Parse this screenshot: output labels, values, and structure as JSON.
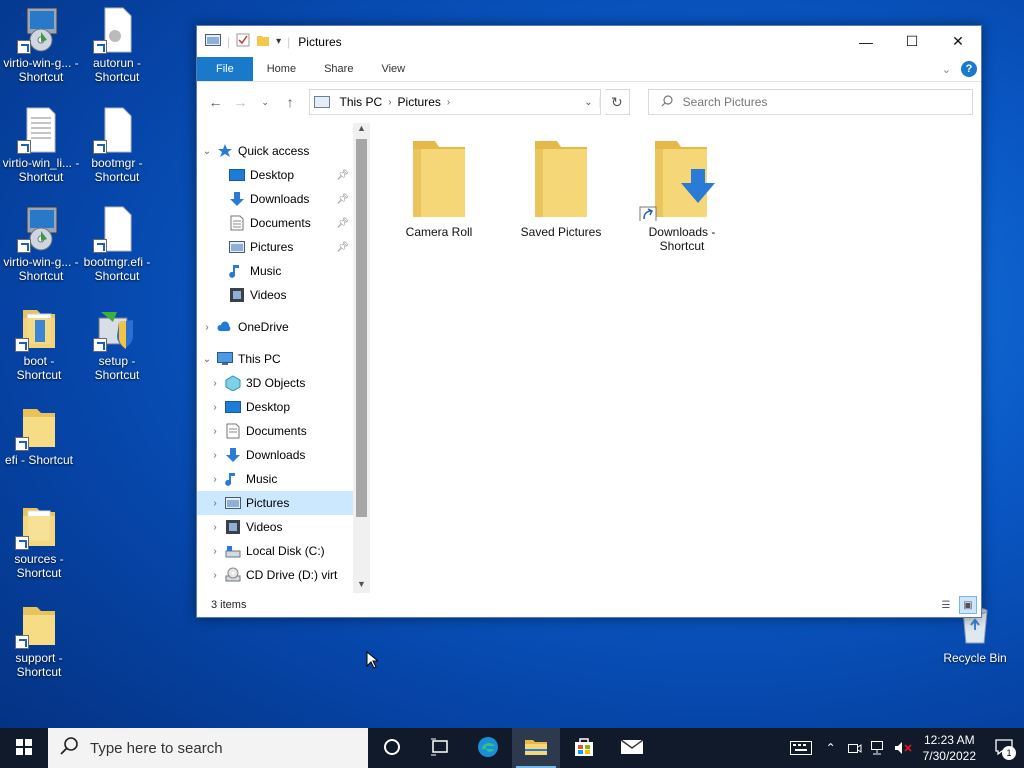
{
  "desktop": {
    "icons": [
      {
        "label": "virtio-win-g... - Shortcut",
        "type": "installer"
      },
      {
        "label": "autorun - Shortcut",
        "type": "file"
      },
      {
        "label": "virtio-win_li... - Shortcut",
        "type": "document"
      },
      {
        "label": "bootmgr - Shortcut",
        "type": "file"
      },
      {
        "label": "virtio-win-g... - Shortcut",
        "type": "installer"
      },
      {
        "label": "bootmgr.efi - Shortcut",
        "type": "file"
      },
      {
        "label": "boot - Shortcut",
        "type": "folder"
      },
      {
        "label": "setup - Shortcut",
        "type": "setup"
      },
      {
        "label": "efi - Shortcut",
        "type": "folder"
      },
      {
        "label": "sources - Shortcut",
        "type": "folder"
      },
      {
        "label": "support - Shortcut",
        "type": "folder"
      },
      {
        "label": "Recycle Bin",
        "type": "recycle-bin"
      }
    ]
  },
  "window": {
    "title": "Pictures",
    "controls": {
      "minimize": "—",
      "maximize": "☐",
      "close": "✕"
    },
    "ribbon_tabs": [
      "File",
      "Home",
      "Share",
      "View"
    ],
    "address": {
      "segments": [
        "This PC",
        "Pictures"
      ]
    },
    "search_placeholder": "Search Pictures",
    "nav": {
      "quick_access": "Quick access",
      "quick_items": [
        "Desktop",
        "Downloads",
        "Documents",
        "Pictures",
        "Music",
        "Videos"
      ],
      "onedrive": "OneDrive",
      "this_pc": "This PC",
      "pc_items": [
        "3D Objects",
        "Desktop",
        "Documents",
        "Downloads",
        "Music",
        "Pictures",
        "Videos",
        "Local Disk (C:)",
        "CD Drive (D:) virt"
      ]
    },
    "files": [
      {
        "label": "Camera Roll"
      },
      {
        "label": "Saved Pictures"
      },
      {
        "label": "Downloads - Shortcut"
      }
    ],
    "status": "3 items"
  },
  "taskbar": {
    "search_placeholder": "Type here to search",
    "time": "12:23 AM",
    "date": "7/30/2022",
    "notification_count": "1"
  }
}
